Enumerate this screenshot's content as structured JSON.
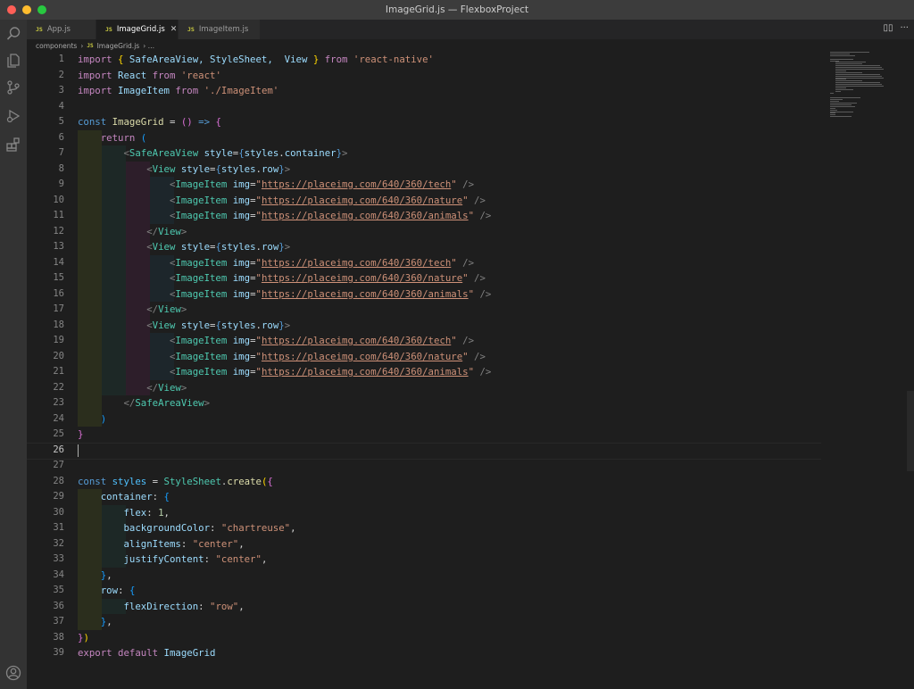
{
  "window": {
    "title": "ImageGrid.js — FlexboxProject"
  },
  "tabs": [
    {
      "icon": "JS",
      "label": "App.js"
    },
    {
      "icon": "JS",
      "label": "ImageGrid.js",
      "close": "✕"
    },
    {
      "icon": "JS",
      "label": "ImageItem.js"
    }
  ],
  "breadcrumb": {
    "folder": "components",
    "sep": "›",
    "icon": "JS",
    "file": "ImageGrid.js",
    "more": "›  …"
  },
  "editor": {
    "line_numbers": [
      "1",
      "2",
      "3",
      "4",
      "5",
      "6",
      "7",
      "8",
      "9",
      "10",
      "11",
      "12",
      "13",
      "14",
      "15",
      "16",
      "17",
      "18",
      "19",
      "20",
      "21",
      "22",
      "23",
      "24",
      "25",
      "26",
      "27",
      "28",
      "29",
      "30",
      "31",
      "32",
      "33",
      "34",
      "35",
      "36",
      "37",
      "38",
      "39"
    ],
    "current_line": 26,
    "imports": {
      "l1_names": "SafeAreaView, StyleSheet,  View",
      "l1_src": "'react-native'",
      "l2_name": "React",
      "l2_src": "'react'",
      "l3_name": "ImageItem",
      "l3_src": "'./ImageItem'"
    },
    "component_name": "ImageGrid",
    "urls": {
      "tech": "https://placeimg.com/640/360/tech",
      "nature": "https://placeimg.com/640/360/nature",
      "animals": "https://placeimg.com/640/360/animals"
    },
    "styles": {
      "flex": "1",
      "backgroundColor": "\"chartreuse\"",
      "alignItems": "\"center\"",
      "justifyContent": "\"center\"",
      "flexDirection": "\"row\""
    }
  },
  "colors": {
    "keyword": "#569cd6",
    "control": "#c586c0",
    "string": "#ce9178",
    "tag": "#4ec9b0",
    "variable": "#9cdcfe"
  },
  "icons": [
    "search-icon",
    "files-icon",
    "source-control-icon",
    "run-debug-icon",
    "extensions-icon",
    "account-icon",
    "split-editor-icon",
    "more-actions-icon"
  ]
}
